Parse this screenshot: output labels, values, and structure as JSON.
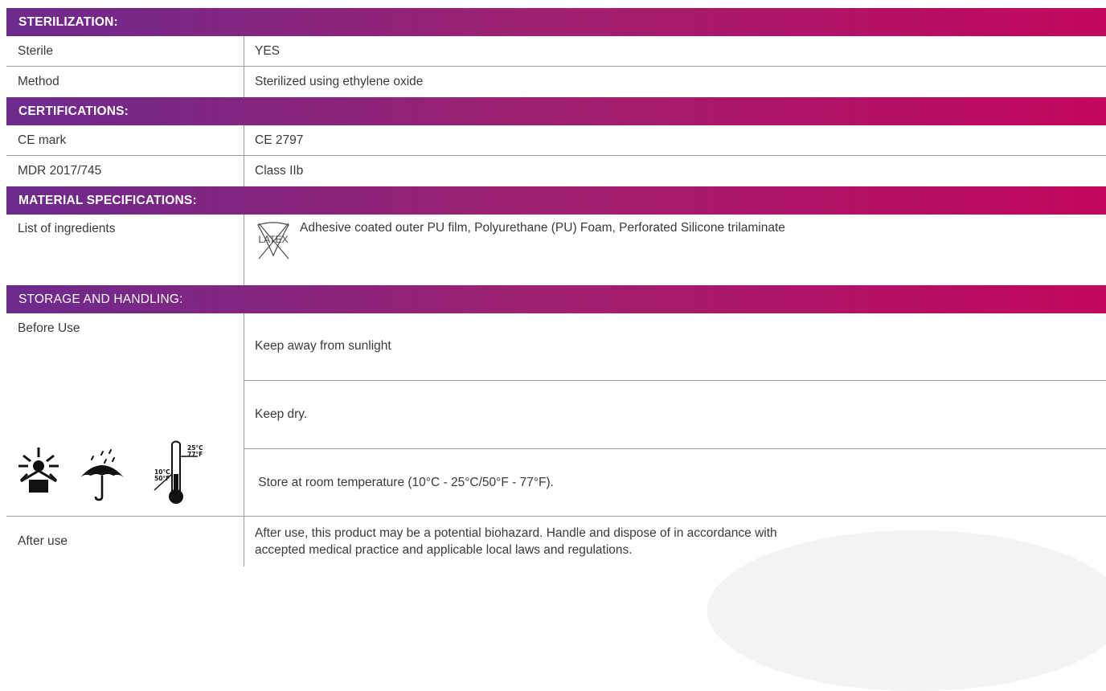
{
  "sterilization": {
    "header": "STERILIZATION:",
    "rows": [
      {
        "label": "Sterile",
        "value": "YES"
      },
      {
        "label": "Method",
        "value": "Sterilized using ethylene oxide"
      }
    ]
  },
  "certifications": {
    "header": "CERTIFICATIONS:",
    "rows": [
      {
        "label": "CE mark",
        "value": "CE 2797"
      },
      {
        "label": "MDR 2017/745",
        "value": "Class IIb"
      }
    ]
  },
  "material": {
    "header": "MATERIAL SPECIFICATIONS:",
    "label": "List of ingredients",
    "latex_symbol_text": "LATEX",
    "value": "Adhesive coated outer PU film, Polyurethane (PU) Foam, Perforated Silicone trilaminate"
  },
  "storage": {
    "header": "STORAGE AND HANDLING:",
    "before_label": "Before Use",
    "temp_icon_text": {
      "max_c": "25°C",
      "max_f": "77°F",
      "min_c": "10°C",
      "min_f": "50°F"
    },
    "before_items": [
      "Keep away from sunlight",
      "Keep dry.",
      " Store at room temperature (10°C - 25°C/50°F - 77°F)."
    ],
    "after_label": "After use",
    "after_value_line1": "After use, this product may be a potential biohazard. Handle and dispose of in accordance with",
    "after_value_line2": "accepted medical practice and applicable local laws and regulations."
  },
  "colors": {
    "header_gradient_start": "#6d2a8e",
    "header_gradient_end": "#c2065f",
    "border": "#9a9a9a",
    "text": "#3a3a3a"
  },
  "icons": [
    "latex-free-icon",
    "keep-away-from-sunlight-icon",
    "keep-dry-icon",
    "temperature-limit-icon"
  ]
}
